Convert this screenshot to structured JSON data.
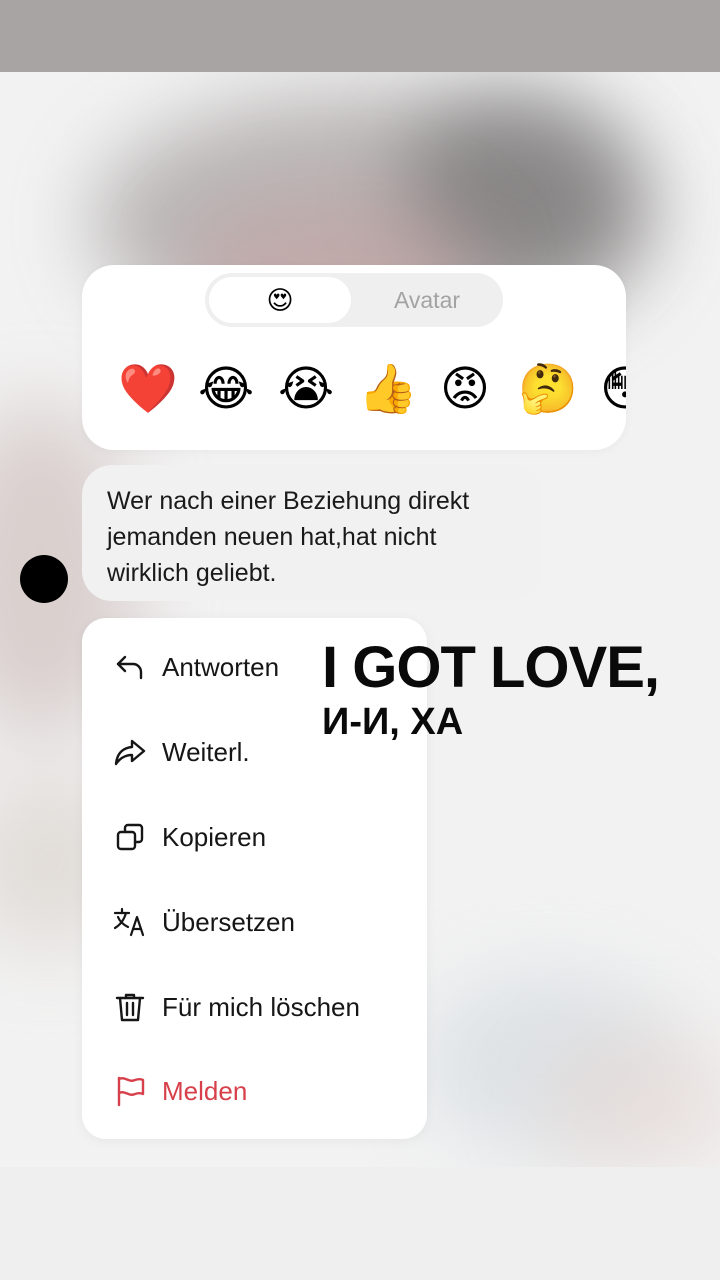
{
  "reaction_picker": {
    "tabs": [
      {
        "label": "😍"
      },
      {
        "label": "Avatar"
      }
    ],
    "emojis": [
      "❤️",
      "😂",
      "😭",
      "👍",
      "😡",
      "🤔",
      "😳"
    ]
  },
  "message": {
    "text": "Wer nach einer Beziehung direkt jemanden neuen hat,hat nicht wirklich geliebt."
  },
  "menu": {
    "items": [
      {
        "label": "Antworten",
        "icon": "reply-icon"
      },
      {
        "label": "Weiterl.",
        "icon": "forward-icon"
      },
      {
        "label": "Kopieren",
        "icon": "copy-icon"
      },
      {
        "label": "Übersetzen",
        "icon": "translate-icon"
      },
      {
        "label": "Für mich löschen",
        "icon": "trash-icon"
      },
      {
        "label": "Melden",
        "icon": "flag-icon",
        "color": "#d7404a"
      }
    ]
  },
  "overlay": {
    "line1": "I GOT LOVE,",
    "line2": "И-И, ХА"
  }
}
